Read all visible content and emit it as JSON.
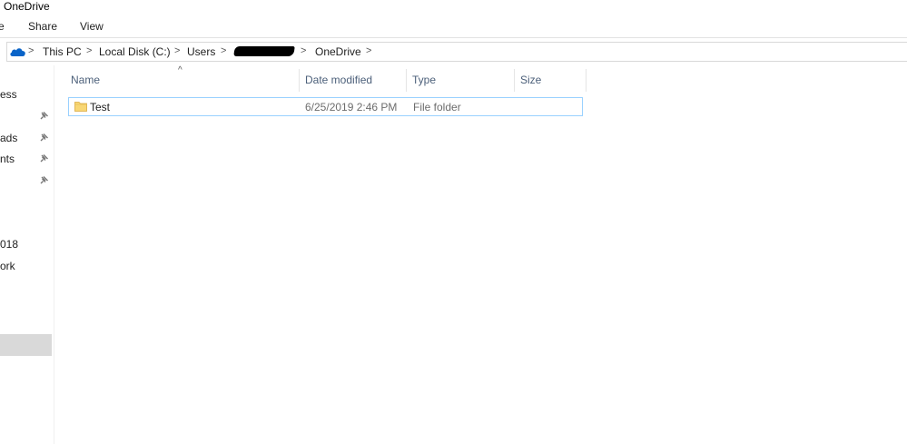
{
  "window": {
    "title": "OneDrive"
  },
  "ribbon": {
    "tabs": [
      "e",
      "Share",
      "View"
    ]
  },
  "address": {
    "icon": "onedrive-cloud-icon",
    "crumbs": [
      "This PC",
      "Local Disk (C:)",
      "Users",
      "OneDrive"
    ],
    "redacted_crumb": "redacted",
    "separator": ">",
    "trailing_chevron": ">"
  },
  "nav": {
    "items": [
      "ess",
      "",
      "ads",
      "nts",
      "",
      "018",
      "ork"
    ],
    "pin_icon": "pin-icon",
    "colors": {
      "selected_bg": "#d9d9d9"
    }
  },
  "columns": {
    "headers": [
      "Name",
      "Date modified",
      "Type",
      "Size"
    ],
    "sort_indicator": "^"
  },
  "files": [
    {
      "icon": "folder-icon",
      "name": "Test",
      "date_modified": "6/25/2019 2:46 PM",
      "type": "File folder",
      "size": ""
    }
  ],
  "colors": {
    "header_text": "#4c607a",
    "row_border": "#99d1ff",
    "cell_secondary": "#6d6d6d",
    "onedrive_blue": "#0a64c8",
    "folder_yellow": "#f8d775"
  }
}
